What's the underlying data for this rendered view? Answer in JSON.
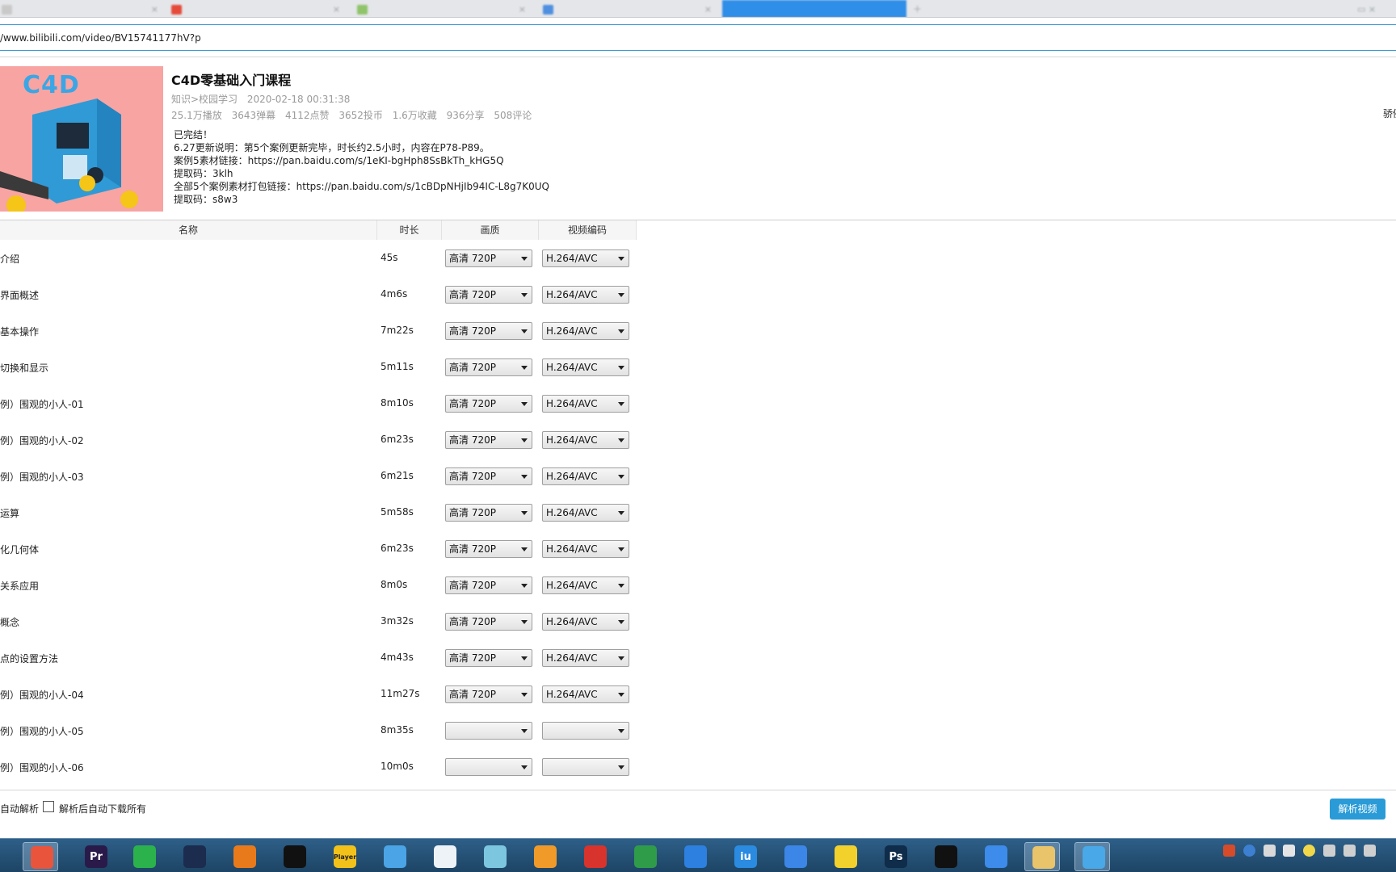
{
  "browser": {
    "address": "/www.bilibili.com/video/BV15741177hV?p"
  },
  "video": {
    "title": "C4D零基础入门课程",
    "thumbnail_text": "C4D",
    "category": "知识>校园学习",
    "published": "2020-02-18 00:31:38",
    "stats": [
      "25.1万播放",
      "3643弹幕",
      "4112点赞",
      "3652投币",
      "1.6万收藏",
      "936分享",
      "508评论"
    ],
    "description": [
      "已完结！",
      "6.27更新说明：第5个案例更新完毕，时长约2.5小时，内容在P78-P89。",
      "案例5素材链接：https://pan.baidu.com/s/1eKI-bgHph8SsBkTh_kHG5Q",
      "提取码：3klh",
      "全部5个案例素材打包链接：https://pan.baidu.com/s/1cBDpNHjIb94IC-L8g7K0UQ",
      "提取码：s8w3"
    ],
    "right_cut_text": "骄例"
  },
  "table": {
    "headers": [
      "名称",
      "时长",
      "画质",
      "视频编码"
    ],
    "rows": [
      {
        "name": "介绍",
        "duration": "45s",
        "quality": "高清 720P",
        "codec": "H.264/AVC"
      },
      {
        "name": "界面概述",
        "duration": "4m6s",
        "quality": "高清 720P",
        "codec": "H.264/AVC"
      },
      {
        "name": "基本操作",
        "duration": "7m22s",
        "quality": "高清 720P",
        "codec": "H.264/AVC"
      },
      {
        "name": "切换和显示",
        "duration": "5m11s",
        "quality": "高清 720P",
        "codec": "H.264/AVC"
      },
      {
        "name": "例）围观的小人-01",
        "duration": "8m10s",
        "quality": "高清 720P",
        "codec": "H.264/AVC"
      },
      {
        "name": "例）围观的小人-02",
        "duration": "6m23s",
        "quality": "高清 720P",
        "codec": "H.264/AVC"
      },
      {
        "name": "例）围观的小人-03",
        "duration": "6m21s",
        "quality": "高清 720P",
        "codec": "H.264/AVC"
      },
      {
        "name": "运算",
        "duration": "5m58s",
        "quality": "高清 720P",
        "codec": "H.264/AVC"
      },
      {
        "name": "化几何体",
        "duration": "6m23s",
        "quality": "高清 720P",
        "codec": "H.264/AVC"
      },
      {
        "name": "关系应用",
        "duration": "8m0s",
        "quality": "高清 720P",
        "codec": "H.264/AVC"
      },
      {
        "name": "概念",
        "duration": "3m32s",
        "quality": "高清 720P",
        "codec": "H.264/AVC"
      },
      {
        "name": "点的设置方法",
        "duration": "4m43s",
        "quality": "高清 720P",
        "codec": "H.264/AVC"
      },
      {
        "name": "例）围观的小人-04",
        "duration": "11m27s",
        "quality": "高清 720P",
        "codec": "H.264/AVC"
      },
      {
        "name": "例）围观的小人-05",
        "duration": "8m35s",
        "quality": "",
        "codec": ""
      },
      {
        "name": "例）围观的小人-06",
        "duration": "10m0s",
        "quality": "",
        "codec": ""
      }
    ]
  },
  "footer": {
    "auto_parse_label": "自动解析",
    "auto_download_label": "解析后自动下载所有",
    "auto_download_checked": false,
    "parse_button": "解析视频"
  },
  "taskbar": {
    "apps": [
      {
        "icon": "chrome-colorful-icon",
        "color": "#e8553c"
      },
      {
        "icon": "premiere-icon",
        "label": "Pr",
        "color": "#2a1a4a"
      },
      {
        "icon": "wechat-icon",
        "color": "#2bb24c"
      },
      {
        "icon": "cinema4d-icon",
        "color": "#1b2c4e"
      },
      {
        "icon": "search-tool-icon",
        "color": "#e87a1c"
      },
      {
        "icon": "qq-icon",
        "color": "#111111"
      },
      {
        "icon": "potplayer-icon",
        "label": "Player",
        "color": "#f2c21a"
      },
      {
        "icon": "browser-bird-icon",
        "color": "#4aa4e6"
      },
      {
        "icon": "davinci-icon",
        "color": "#eef3f8"
      },
      {
        "icon": "flower-app-icon",
        "color": "#7cc6e0"
      },
      {
        "icon": "music-avatar-icon",
        "color": "#f09a2a"
      },
      {
        "icon": "netease-music-icon",
        "color": "#d8332c"
      },
      {
        "icon": "chrome-icon",
        "color": "#2f9c4a"
      },
      {
        "icon": "wps-icon",
        "color": "#2d7fe0"
      },
      {
        "icon": "iqiyi-icon",
        "label": "iu",
        "color": "#2a8be0"
      },
      {
        "icon": "pen-app-icon",
        "color": "#3b86e6"
      },
      {
        "icon": "qqmusic-icon",
        "color": "#f2d12c"
      },
      {
        "icon": "photoshop-icon",
        "label": "Ps",
        "color": "#0f2c4a"
      },
      {
        "icon": "capcut-icon",
        "color": "#111111"
      },
      {
        "icon": "feishu-icon",
        "color": "#3d8bea"
      },
      {
        "icon": "file-explorer-icon",
        "color": "#e9c46a"
      },
      {
        "icon": "bilibili-tv-icon",
        "color": "#49a8e8"
      }
    ]
  }
}
